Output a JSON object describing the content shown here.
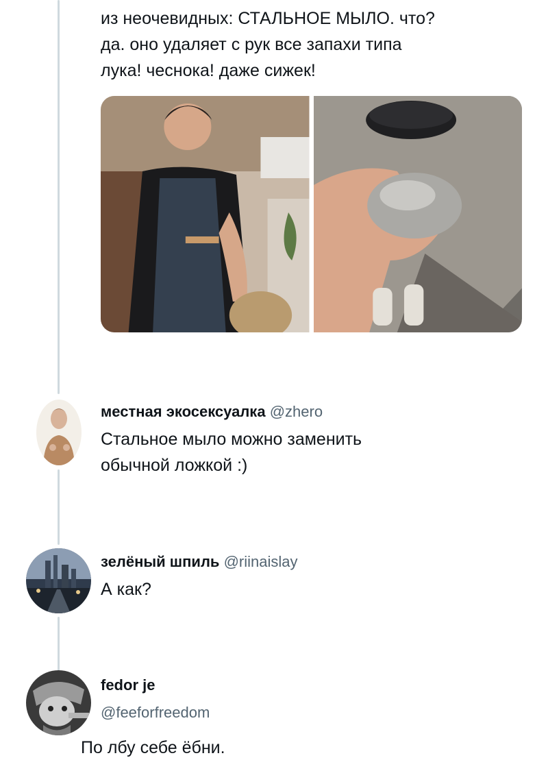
{
  "main_tweet": {
    "text_lines": [
      "из неочевидных: СТАЛЬНОЕ МЫЛО. что?",
      "да. оно удаляет с рук все запахи типа",
      "лука! чеснока! даже сижек!"
    ],
    "media": [
      "photo-woman-in-apron",
      "photo-steel-soap-in-hand"
    ]
  },
  "replies": [
    {
      "name": "местная экосексуалка",
      "handle": "@zhero",
      "text_lines": [
        "Стальное мыло можно заменить",
        "обычной ложкой :)"
      ]
    },
    {
      "name": "зелёный шпиль",
      "handle": "@riinaislay",
      "text_lines": [
        "А как?"
      ]
    },
    {
      "name": "fedor je",
      "handle": "@feeforfreedom",
      "text_lines": [
        "По лбу себе ёбни."
      ]
    }
  ],
  "colors": {
    "text": "#0f1419",
    "secondary": "#536471",
    "thread_line": "#cfd9de"
  }
}
